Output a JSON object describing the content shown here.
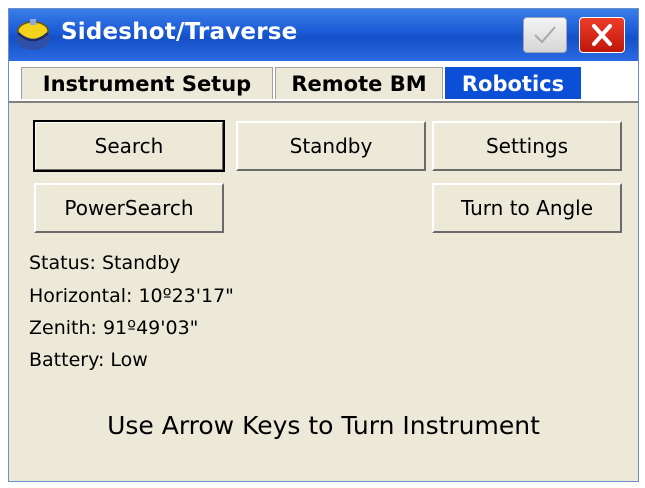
{
  "window": {
    "title": "Sideshot/Traverse"
  },
  "tabs": [
    {
      "label": "Instrument Setup",
      "active": false
    },
    {
      "label": "Remote BM",
      "active": false
    },
    {
      "label": "Robotics",
      "active": true
    }
  ],
  "buttons": {
    "search": "Search",
    "standby": "Standby",
    "settings": "Settings",
    "powersearch": "PowerSearch",
    "turn_to_angle": "Turn to Angle"
  },
  "status": {
    "status": "Status: Standby",
    "horizontal": "Horizontal: 10º23'17\"",
    "zenith": "Zenith: 91º49'03\"",
    "battery": "Battery: Low"
  },
  "hint": "Use Arrow Keys to Turn Instrument",
  "colors": {
    "titlebar": "#1b5ad6",
    "active_tab": "#0a4fd6",
    "close_button": "#d9241a",
    "panel": "#ece9d8"
  }
}
